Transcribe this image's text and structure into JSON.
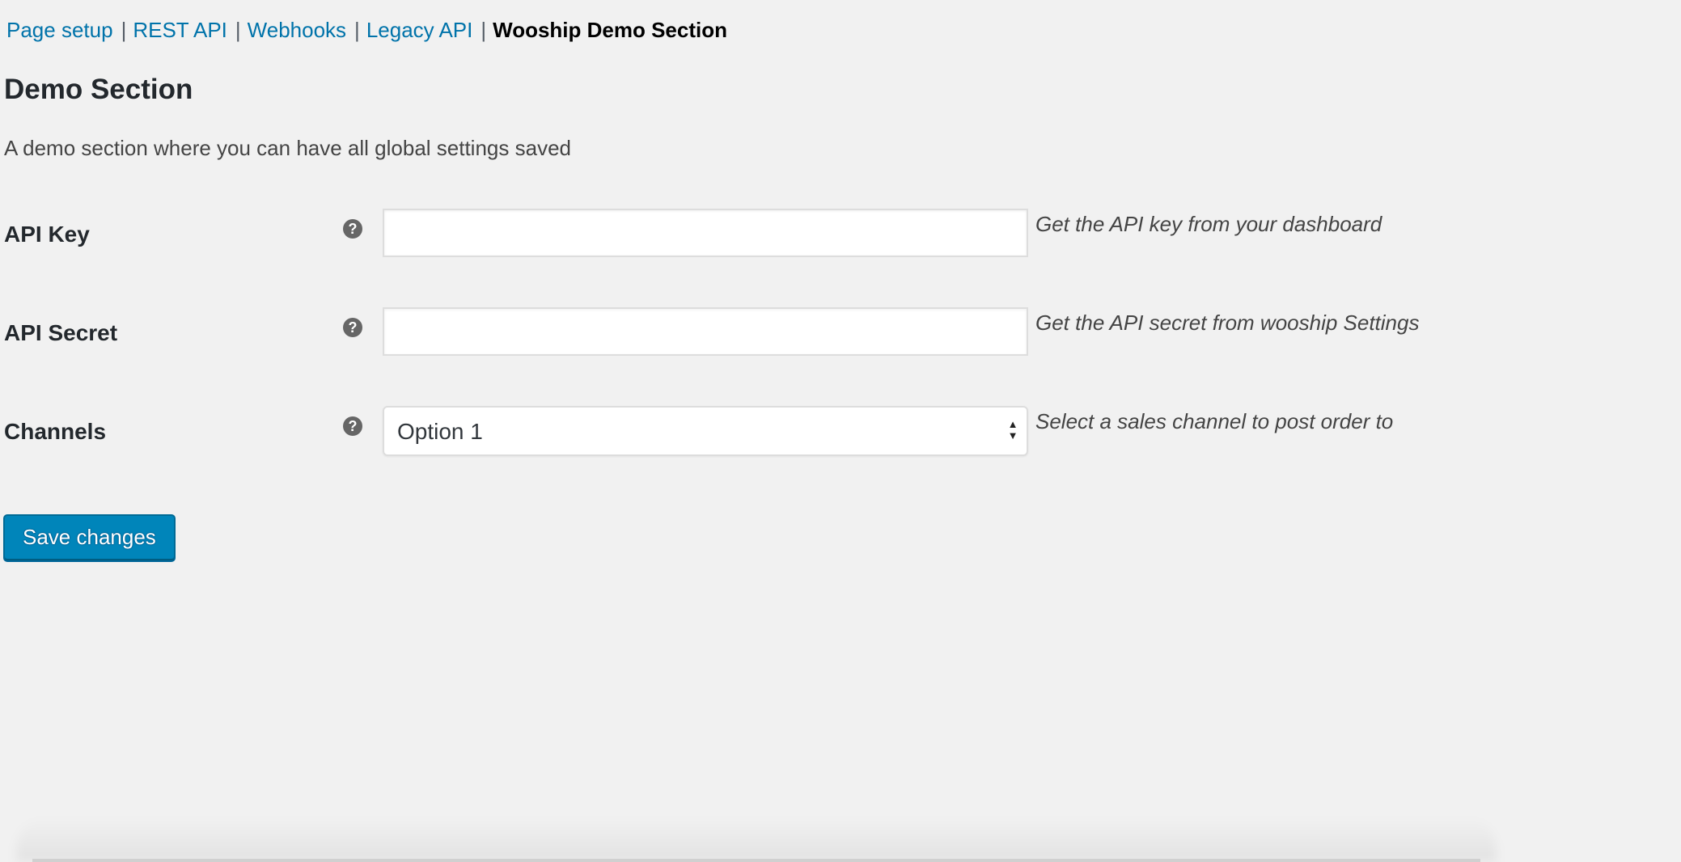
{
  "nav": {
    "links": [
      {
        "label": "Page setup"
      },
      {
        "label": "REST API"
      },
      {
        "label": "Webhooks"
      },
      {
        "label": "Legacy API"
      }
    ],
    "separator": "|",
    "current": "Wooship Demo Section"
  },
  "section": {
    "title": "Demo Section",
    "description": "A demo section where you can have all global settings saved"
  },
  "fields": {
    "api_key": {
      "label": "API Key",
      "help_icon": "question-circle-icon",
      "help_glyph": "?",
      "value": "",
      "description": "Get the API key from your dashboard"
    },
    "api_secret": {
      "label": "API Secret",
      "help_icon": "question-circle-icon",
      "help_glyph": "?",
      "value": "",
      "description": "Get the API secret from wooship Settings"
    },
    "channels": {
      "label": "Channels",
      "help_icon": "question-circle-icon",
      "help_glyph": "?",
      "selected": "Option 1",
      "description": "Select a sales channel to post order to"
    }
  },
  "actions": {
    "save_label": "Save changes"
  },
  "colors": {
    "link": "#0073aa",
    "button": "#0085ba",
    "background": "#f1f1f1"
  }
}
